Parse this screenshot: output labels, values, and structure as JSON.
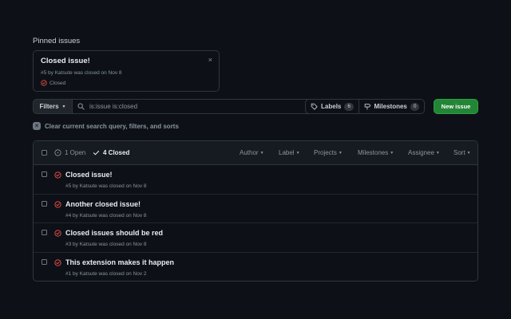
{
  "pinned": {
    "heading": "Pinned issues",
    "card": {
      "title": "Closed issue!",
      "meta": "#5 by Katsute was closed on Nov 8",
      "status": "Closed",
      "close_glyph": "×"
    }
  },
  "toolbar": {
    "filters_label": "Filters",
    "search_value": "is:issue is:closed",
    "labels_label": "Labels",
    "labels_count": "6",
    "milestones_label": "Milestones",
    "milestones_count": "0",
    "new_issue_label": "New issue"
  },
  "clear": {
    "label": "Clear current search query, filters, and sorts"
  },
  "list_header": {
    "open_label": "1 Open",
    "closed_label": "4 Closed",
    "filters": [
      {
        "label": "Author"
      },
      {
        "label": "Label"
      },
      {
        "label": "Projects"
      },
      {
        "label": "Milestones"
      },
      {
        "label": "Assignee"
      },
      {
        "label": "Sort"
      }
    ]
  },
  "issues": [
    {
      "title": "Closed issue!",
      "meta": "#5 by Katsute was closed on Nov 8"
    },
    {
      "title": "Another closed issue!",
      "meta": "#4 by Katsute was closed on Nov 8"
    },
    {
      "title": "Closed issues should be red",
      "meta": "#3 by Katsute was closed on Nov 8"
    },
    {
      "title": "This extension makes it happen",
      "meta": "#1 by Katsute was closed on Nov 2"
    }
  ],
  "colors": {
    "background": "#0d1117",
    "closed_red": "#f85149",
    "primary_green": "#238636",
    "border": "#30363d"
  }
}
